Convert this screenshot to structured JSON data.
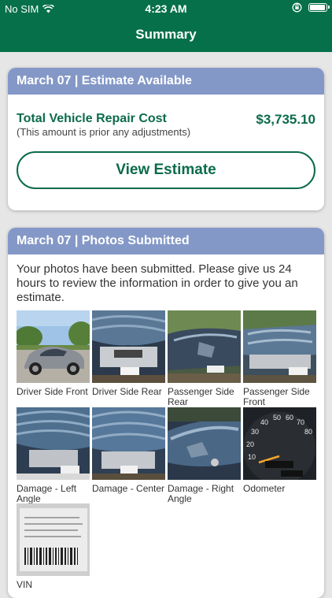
{
  "status": {
    "carrier": "No SIM",
    "time": "4:23 AM"
  },
  "nav": {
    "title": "Summary"
  },
  "estimate_card": {
    "header": "March 07 | Estimate Available",
    "cost_label": "Total Vehicle Repair Cost",
    "cost_value": "$3,735.10",
    "cost_note": "(This amount is prior any adjustments)",
    "button_label": "View Estimate"
  },
  "photos_card": {
    "header": "March 07 | Photos Submitted",
    "description": "Your photos have been submitted. Please give us 24 hours to review the information in order to give you an estimate.",
    "photos": [
      {
        "caption": "Driver Side Front"
      },
      {
        "caption": "Driver Side Rear"
      },
      {
        "caption": "Passenger Side Rear"
      },
      {
        "caption": "Passenger Side Front"
      },
      {
        "caption": "Damage - Left Angle"
      },
      {
        "caption": "Damage - Center"
      },
      {
        "caption": "Damage - Right Angle"
      },
      {
        "caption": "Odometer"
      },
      {
        "caption": "VIN"
      }
    ]
  },
  "colors": {
    "brand_green": "#05704a",
    "header_blue": "#8498c7"
  },
  "icons": [
    "wifi-icon",
    "orientation-lock-icon",
    "battery-icon",
    "car-photo",
    "odometer-photo",
    "vin-photo"
  ]
}
